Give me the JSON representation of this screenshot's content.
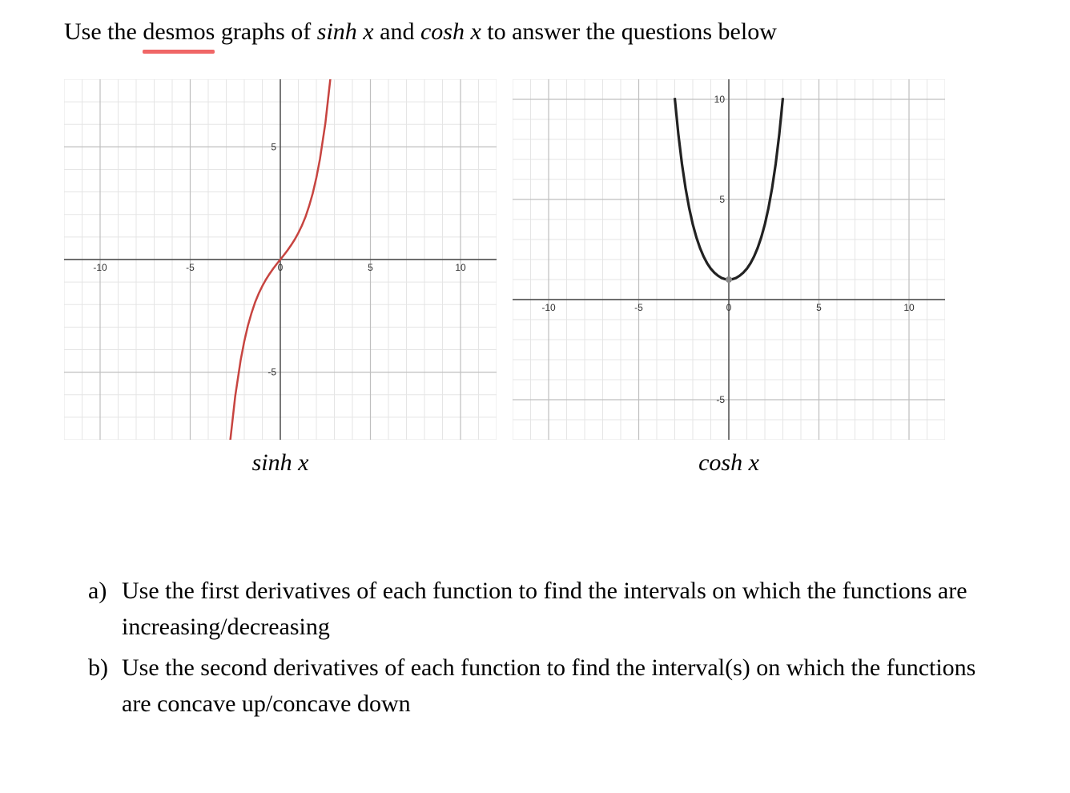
{
  "instruction": {
    "pre": "Use the ",
    "link": "desmos",
    "mid1": " graphs of ",
    "f1": "sinh x",
    "mid2": " and ",
    "f2": "cosh x",
    "post": " to answer the questions below"
  },
  "charts": [
    {
      "label": "sinh x"
    },
    {
      "label": "cosh x"
    }
  ],
  "chart_data": [
    {
      "type": "line",
      "title": "sinh x",
      "xlabel": "",
      "ylabel": "",
      "xlim": [
        -12,
        12
      ],
      "ylim": [
        -8,
        8
      ],
      "x_ticks": [
        -10,
        -5,
        0,
        5,
        10
      ],
      "y_ticks": [
        -5,
        5
      ],
      "series": [
        {
          "name": "sinh x",
          "color": "#c74440",
          "x": [
            -2.8,
            -2.5,
            -2.2,
            -2.0,
            -1.8,
            -1.6,
            -1.4,
            -1.2,
            -1.0,
            -0.8,
            -0.6,
            -0.4,
            -0.2,
            0,
            0.2,
            0.4,
            0.6,
            0.8,
            1.0,
            1.2,
            1.4,
            1.6,
            1.8,
            2.0,
            2.2,
            2.5,
            2.8
          ],
          "y": [
            -8.19,
            -6.05,
            -4.46,
            -3.63,
            -2.94,
            -2.38,
            -1.9,
            -1.51,
            -1.18,
            -0.89,
            -0.64,
            -0.41,
            -0.2,
            0,
            0.2,
            0.41,
            0.64,
            0.89,
            1.18,
            1.51,
            1.9,
            2.38,
            2.94,
            3.63,
            4.46,
            6.05,
            8.19
          ]
        }
      ]
    },
    {
      "type": "line",
      "title": "cosh x",
      "xlabel": "",
      "ylabel": "",
      "xlim": [
        -12,
        12
      ],
      "ylim": [
        -7,
        11
      ],
      "x_ticks": [
        -10,
        -5,
        0,
        5,
        10
      ],
      "y_ticks": [
        -5,
        5,
        10
      ],
      "series": [
        {
          "name": "cosh x",
          "color": "#222",
          "x": [
            -3.0,
            -2.8,
            -2.6,
            -2.4,
            -2.2,
            -2.0,
            -1.8,
            -1.6,
            -1.4,
            -1.2,
            -1.0,
            -0.8,
            -0.6,
            -0.4,
            -0.2,
            0,
            0.2,
            0.4,
            0.6,
            0.8,
            1.0,
            1.2,
            1.4,
            1.6,
            1.8,
            2.0,
            2.2,
            2.4,
            2.6,
            2.8,
            3.0
          ],
          "y": [
            10.07,
            8.25,
            6.77,
            5.56,
            4.57,
            3.76,
            3.11,
            2.58,
            2.15,
            1.81,
            1.54,
            1.34,
            1.19,
            1.08,
            1.02,
            1.0,
            1.02,
            1.08,
            1.19,
            1.34,
            1.54,
            1.81,
            2.15,
            2.58,
            3.11,
            3.76,
            4.57,
            5.56,
            6.77,
            8.25,
            10.07
          ]
        }
      ],
      "marker": {
        "x": 0,
        "y": 1
      }
    }
  ],
  "questions": [
    {
      "marker": "a)",
      "text": "Use the first derivatives of each function to find the intervals on which the functions are increasing/decreasing"
    },
    {
      "marker": "b)",
      "text": "Use the second derivatives of each function to find the interval(s) on which the functions are concave up/concave down"
    }
  ]
}
